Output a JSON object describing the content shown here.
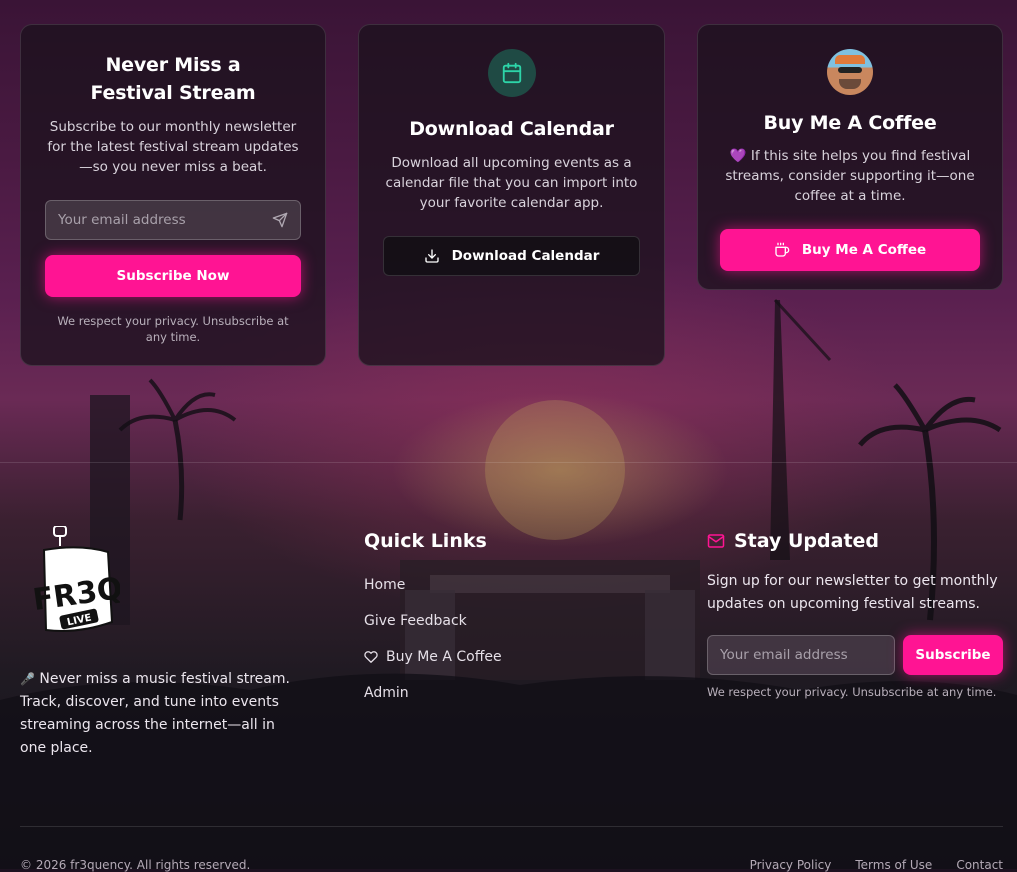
{
  "newsletter_card": {
    "title": "Never Miss a Festival Stream",
    "description": "Subscribe to our monthly newsletter for the latest festival stream updates—so you never miss a beat.",
    "email_placeholder": "Your email address",
    "button_label": "Subscribe Now",
    "privacy_note": "We respect your privacy. Unsubscribe at any time."
  },
  "calendar_card": {
    "icon": "calendar-icon",
    "title": "Download Calendar",
    "description": "Download all upcoming events as a calendar file that you can import into your favorite calendar app.",
    "button_label": "Download Calendar",
    "button_icon": "download-icon"
  },
  "coffee_card": {
    "avatar": "avatar",
    "title": "Buy Me A Coffee",
    "heart_emoji": "💜",
    "description": "If this site helps you find festival streams, consider supporting it—one coffee at a time.",
    "button_label": "Buy Me A Coffee",
    "button_icon": "coffee-cup-icon"
  },
  "footer": {
    "about": {
      "emoji": "🎤",
      "text": "Never miss a music festival stream. Track, discover, and tune into events streaming across the internet—all in one place."
    },
    "quick_links": {
      "title": "Quick Links",
      "items": [
        {
          "label": "Home"
        },
        {
          "label": "Give Feedback"
        },
        {
          "label": "Buy Me A Coffee",
          "icon": "heart-icon"
        },
        {
          "label": "Admin"
        }
      ]
    },
    "stay_updated": {
      "title": "Stay Updated",
      "icon": "mail-icon",
      "description": "Sign up for our newsletter to get monthly updates on upcoming festival streams.",
      "email_placeholder": "Your email address",
      "button_label": "Subscribe",
      "privacy_note": "We respect your privacy. Unsubscribe at any time."
    },
    "copyright": "© 2026 fr3quency. All rights reserved.",
    "legal_links": [
      "Privacy Policy",
      "Terms of Use",
      "Contact"
    ]
  },
  "colors": {
    "accent": "#ff1493",
    "calendar_accent": "#2dd4a8",
    "card_bg": "#1c121e"
  }
}
